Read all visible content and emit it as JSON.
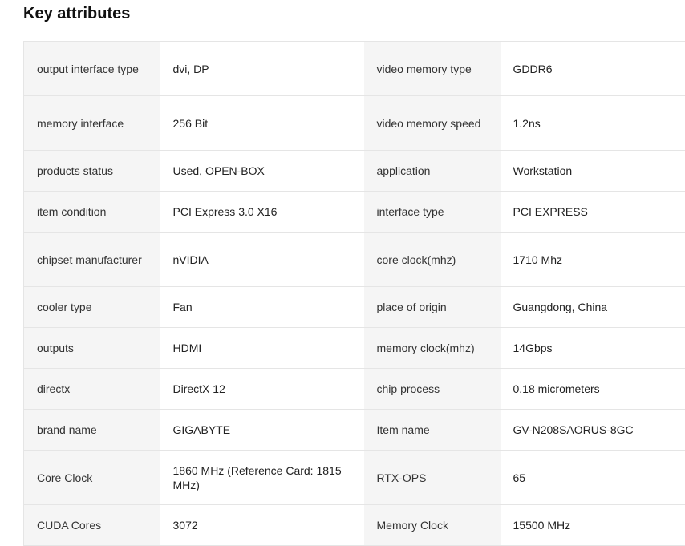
{
  "title": "Key attributes",
  "rows": [
    [
      {
        "k": "output interface type",
        "v": "dvi, DP"
      },
      {
        "k": "video memory type",
        "v": "GDDR6"
      }
    ],
    [
      {
        "k": "memory interface",
        "v": "256 Bit"
      },
      {
        "k": "video memory speed",
        "v": "1.2ns"
      }
    ],
    [
      {
        "k": "products status",
        "v": "Used, OPEN-BOX"
      },
      {
        "k": "application",
        "v": "Workstation"
      }
    ],
    [
      {
        "k": "item condition",
        "v": "PCI Express 3.0 X16"
      },
      {
        "k": "interface type",
        "v": "PCI EXPRESS"
      }
    ],
    [
      {
        "k": "chipset manufacturer",
        "v": "nVIDIA"
      },
      {
        "k": "core clock(mhz)",
        "v": "1710 Mhz"
      }
    ],
    [
      {
        "k": "cooler type",
        "v": "Fan"
      },
      {
        "k": "place of origin",
        "v": "Guangdong, China"
      }
    ],
    [
      {
        "k": "outputs",
        "v": "HDMI"
      },
      {
        "k": "memory clock(mhz)",
        "v": "14Gbps"
      }
    ],
    [
      {
        "k": "directx",
        "v": "DirectX 12"
      },
      {
        "k": "chip process",
        "v": "0.18 micrometers"
      }
    ],
    [
      {
        "k": "brand name",
        "v": "GIGABYTE"
      },
      {
        "k": "Item name",
        "v": "GV-N208SAORUS-8GC"
      }
    ],
    [
      {
        "k": "Core Clock",
        "v": "1860 MHz (Reference Card: 1815 MHz)"
      },
      {
        "k": "RTX-OPS",
        "v": "65"
      }
    ],
    [
      {
        "k": "CUDA Cores",
        "v": "3072"
      },
      {
        "k": "Memory Clock",
        "v": "15500 MHz"
      }
    ]
  ]
}
